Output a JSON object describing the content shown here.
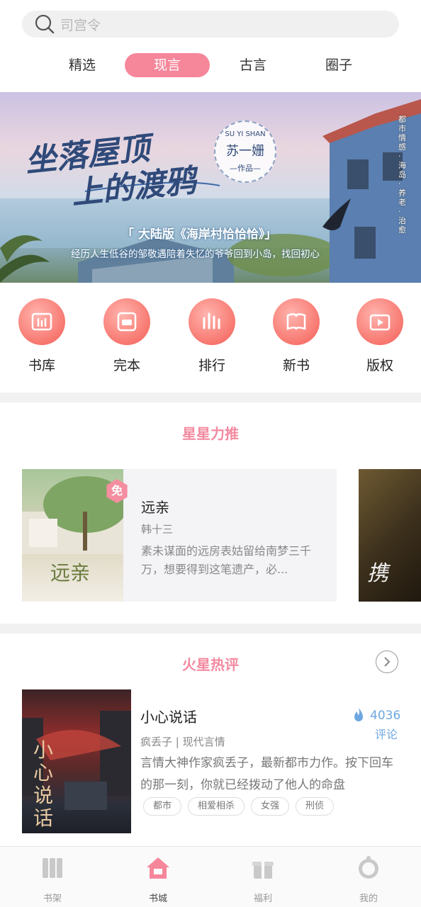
{
  "search": {
    "placeholder": "司宫令"
  },
  "tabs": [
    {
      "label": "精选",
      "active": false
    },
    {
      "label": "现言",
      "active": true
    },
    {
      "label": "古言",
      "active": false
    },
    {
      "label": "圈子",
      "active": false
    }
  ],
  "banner": {
    "title_line1": "坐落屋顶",
    "title_line2": "上的渡鸦",
    "author_en": "SU YI SHAN",
    "author": "苏一姗",
    "author_suffix": "—作品—",
    "headline": "「 大陆版《海岸村恰恰恰》」",
    "tagline": "经历人生低谷的邹敬遇陪着失忆的爷爷回到小岛，找回初心",
    "side_text": "都市情感·海岛·养老·治愈"
  },
  "categories": [
    {
      "label": "书库",
      "icon": "library-icon"
    },
    {
      "label": "完本",
      "icon": "end-icon"
    },
    {
      "label": "排行",
      "icon": "ranking-icon"
    },
    {
      "label": "新书",
      "icon": "new-book-icon"
    },
    {
      "label": "版权",
      "icon": "copyright-icon"
    }
  ],
  "recommend": {
    "section_title": "星星力推",
    "badge": "免",
    "book": {
      "title": "远亲",
      "author": "韩十三",
      "desc": "素未谋面的远房表姑留给南梦三千万，想要得到这笔遗产，必...",
      "cover_title": "远亲"
    },
    "next_cover_title": "携"
  },
  "hot": {
    "section_title": "火星热评",
    "book": {
      "title": "小心说话",
      "author": "疯丢子",
      "genre": "现代言情",
      "meta": "疯丢子 | 现代言情",
      "desc": "言情大神作家疯丢子，最新都市力作。按下回车的那一刻，你就已经拨动了他人的命盘",
      "comment_count": "4036",
      "comment_label": "评论",
      "cover_title": "小心说话",
      "tags": [
        "都市",
        "相爱相杀",
        "女强",
        "刑侦"
      ]
    }
  },
  "nav": [
    {
      "label": "书架",
      "active": false
    },
    {
      "label": "书城",
      "active": true
    },
    {
      "label": "福利",
      "active": false
    },
    {
      "label": "我的",
      "active": false
    }
  ],
  "colors": {
    "accent": "#f6869a",
    "section_title": "#f38aa0",
    "comment_blue": "#6ea7e0"
  }
}
